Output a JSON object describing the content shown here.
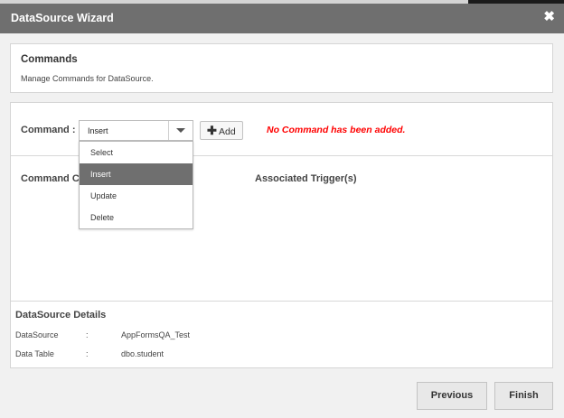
{
  "dialog": {
    "title": "DataSource Wizard",
    "close_icon": "close-icon"
  },
  "commands_panel": {
    "heading": "Commands",
    "description": "Manage Commands for DataSource."
  },
  "command_row": {
    "label": "Command  :",
    "selected_value": "Insert",
    "add_label": "Add",
    "add_icon": "plus-icon",
    "warning": "No Command has been added.",
    "warning_color": "#ff0000"
  },
  "dropdown": {
    "options": [
      "Select",
      "Insert",
      "Update",
      "Delete"
    ],
    "highlighted": "Insert"
  },
  "sections": {
    "command_columns": "Command Co",
    "associated_triggers": "Associated Trigger(s)"
  },
  "datasource_details": {
    "heading": "DataSource Details",
    "rows": [
      {
        "label": "DataSource",
        "sep": ":",
        "value": "AppFormsQA_Test"
      },
      {
        "label": "Data Table",
        "sep": ":",
        "value": "dbo.student"
      }
    ]
  },
  "footer": {
    "previous": "Previous",
    "finish": "Finish"
  },
  "colors": {
    "titlebar": "#6f6f6f",
    "highlight": "#6f6f6f",
    "background": "#f1f1f1"
  }
}
